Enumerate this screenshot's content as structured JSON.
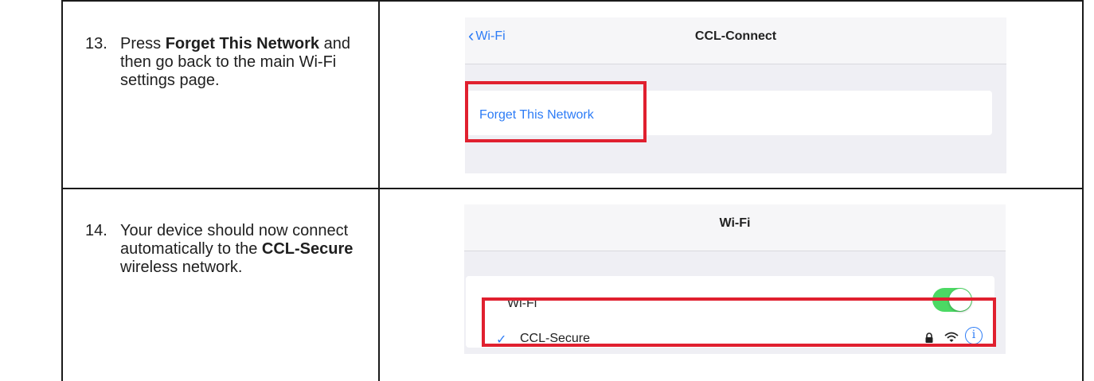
{
  "steps": [
    {
      "number": "13.",
      "pre": "Press ",
      "bold": "Forget This Network",
      "post": " and then go back to the main Wi-Fi settings page."
    },
    {
      "number": "14.",
      "pre": "Your device should now connect automatically to the ",
      "bold": "CCL-Secure",
      "post": " wireless network."
    }
  ],
  "screen1": {
    "back_label": "Wi-Fi",
    "title": "CCL-Connect",
    "forget_label": "Forget This Network"
  },
  "screen2": {
    "title": "Wi-Fi",
    "wifi_row_label": "Wi-Fi",
    "wifi_toggle_on": true,
    "network_name": "CCL-Secure",
    "info_glyph": "i"
  },
  "icons": [
    "chevron-left-icon",
    "checkmark-icon",
    "lock-icon",
    "wifi-signal-icon",
    "info-icon"
  ],
  "colors": {
    "ios_blue": "#2d7cf6",
    "highlight_red": "#e0202f",
    "toggle_green": "#4cd964"
  }
}
